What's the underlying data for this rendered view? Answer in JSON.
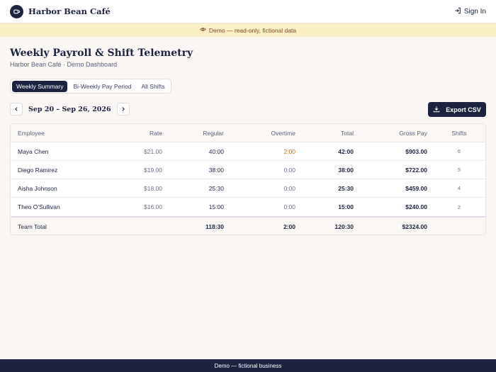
{
  "header": {
    "brand_name": "Harbor Bean Café",
    "signin_label": "Sign In"
  },
  "banner": {
    "text": "Demo — read-only, fictional data"
  },
  "page": {
    "title": "Weekly Payroll & Shift Telemetry",
    "subtitle": "Harbor Bean Café · Demo Dashboard"
  },
  "tabs": [
    {
      "label": "Weekly Summary",
      "active": true
    },
    {
      "label": "Bi-Weekly Pay Period",
      "active": false
    },
    {
      "label": "All Shifts",
      "active": false
    }
  ],
  "week_nav": {
    "label": "Sep 20 – Sep 26, 2026"
  },
  "export_label": "Export CSV",
  "table": {
    "columns": {
      "employee": "Employee",
      "rate": "Rate",
      "regular": "Regular",
      "overtime": "Overtime",
      "total": "Total",
      "gross": "Gross Pay",
      "shifts": "Shifts"
    },
    "rows": [
      {
        "employee": "Maya Chen",
        "rate": "$21.00",
        "regular": "40:00",
        "overtime": "2:00",
        "total": "42:00",
        "gross": "$903.00",
        "shifts": "6"
      },
      {
        "employee": "Diego Ramirez",
        "rate": "$19.00",
        "regular": "38:00",
        "overtime": "0:00",
        "total": "38:00",
        "gross": "$722.00",
        "shifts": "5"
      },
      {
        "employee": "Aisha Johnson",
        "rate": "$18.00",
        "regular": "25:30",
        "overtime": "0:00",
        "total": "25:30",
        "gross": "$459.00",
        "shifts": "4"
      },
      {
        "employee": "Theo O'Sullivan",
        "rate": "$16.00",
        "regular": "15:00",
        "overtime": "0:00",
        "total": "15:00",
        "gross": "$240.00",
        "shifts": "2"
      }
    ],
    "totals": {
      "label": "Team Total",
      "regular": "118:30",
      "overtime": "2:00",
      "total": "120:30",
      "gross": "$2324.00"
    }
  },
  "footer": {
    "text": "Demo — fictional business"
  },
  "colors": {
    "navy": "#1b2340",
    "banner_bg": "#fbefc6",
    "overtime_accent": "#c2691a",
    "page_bg": "#faf6f4"
  },
  "icons": {
    "brand": "coffee-cup-icon",
    "signin": "sign-in-icon",
    "banner": "eye-icon",
    "prev": "chevron-left-icon",
    "next": "chevron-right-icon",
    "export": "download-icon"
  }
}
